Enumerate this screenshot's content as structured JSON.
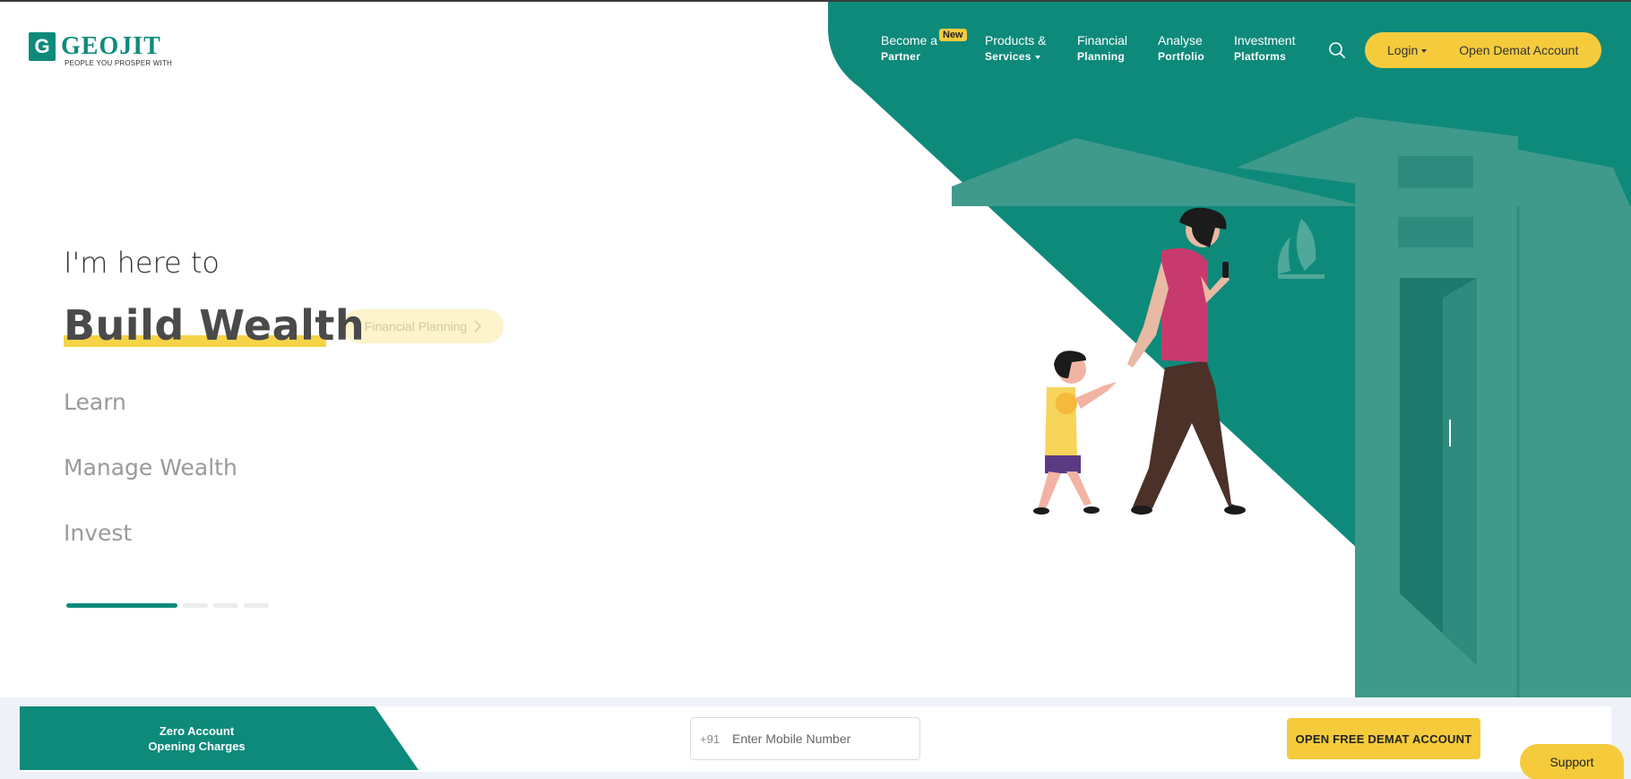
{
  "brand": {
    "name": "GEOJIT",
    "tagline": "PEOPLE YOU PROSPER WITH",
    "logo_letter": "G",
    "accent_color": "#0e8a7b",
    "yellow_color": "#f5cb3c"
  },
  "nav": {
    "partner": {
      "line1": "Become a",
      "line2": "Partner",
      "badge": "New"
    },
    "products": {
      "line1": "Products &",
      "line2": "Services"
    },
    "planning": {
      "line1": "Financial",
      "line2": "Planning"
    },
    "analyse": {
      "line1": "Analyse",
      "line2": "Portfolio"
    },
    "platforms": {
      "line1": "Investment",
      "line2": "Platforms"
    },
    "search_icon": "search-icon",
    "login_label": "Login",
    "demat_label": "Open Demat Account"
  },
  "hero": {
    "intro": "I'm here to",
    "title": "Build Wealth",
    "chip_label": "Financial Planning",
    "options": [
      "Learn",
      "Manage Wealth",
      "Invest"
    ],
    "slides_total": 4,
    "active_slide": 1
  },
  "bottom_bar": {
    "promo_line1": "Zero Account",
    "promo_line2": "Opening Charges",
    "country_code": "+91",
    "mobile_placeholder": "Enter Mobile Number",
    "cta_label": "OPEN FREE DEMAT ACCOUNT"
  },
  "support": {
    "label": "Support"
  }
}
